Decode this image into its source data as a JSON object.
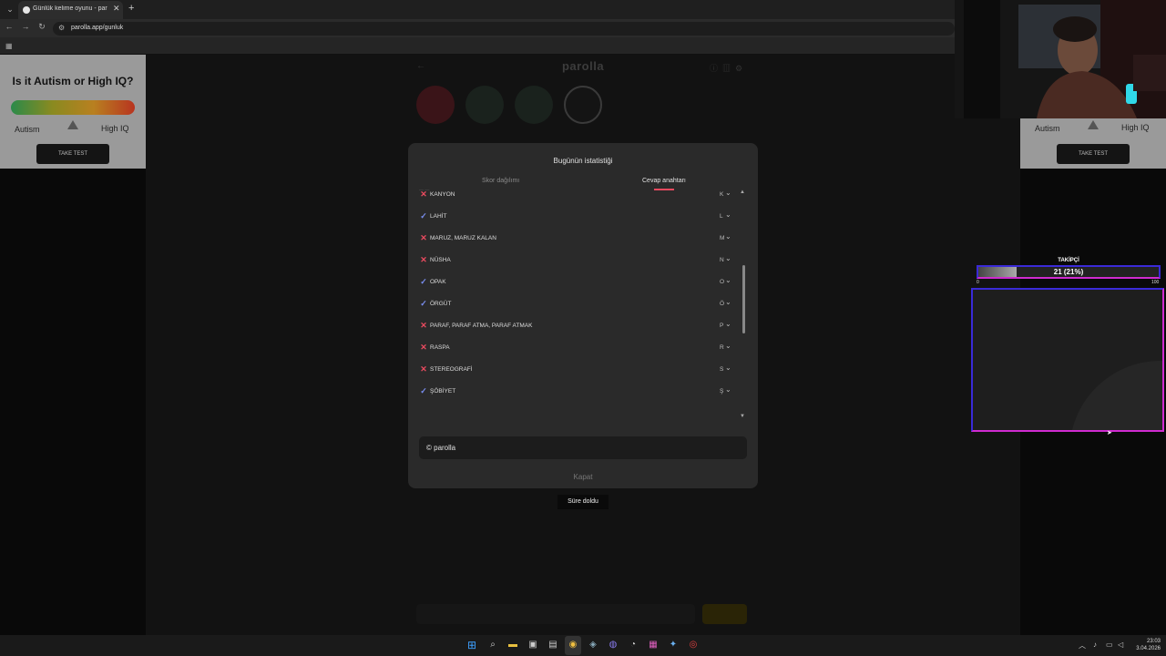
{
  "browser": {
    "tab_title": "Günlük kelime oyunu - parolla",
    "url": "parolla.app/gunluk"
  },
  "ads": {
    "title": "Is it Autism or High IQ?",
    "label_low": "Autism",
    "label_high": "High IQ",
    "button": "TAKE TEST"
  },
  "game": {
    "logo": "parolla"
  },
  "modal": {
    "title": "Bugünün istatistiği",
    "tab_scores": "Skor dağılımı",
    "tab_answers": "Cevap anahtarı",
    "answers": [
      {
        "word": "KANYON",
        "letter": "K",
        "correct": false
      },
      {
        "word": "LAHİT",
        "letter": "L",
        "correct": true
      },
      {
        "word": "MARUZ, MARUZ KALAN",
        "letter": "M",
        "correct": false
      },
      {
        "word": "NÜSHA",
        "letter": "N",
        "correct": false
      },
      {
        "word": "OPAK",
        "letter": "O",
        "correct": true
      },
      {
        "word": "ÖRGÜT",
        "letter": "Ö",
        "correct": true
      },
      {
        "word": "PARAF, PARAF ATMA, PARAF ATMAK",
        "letter": "P",
        "correct": false
      },
      {
        "word": "RASPA",
        "letter": "R",
        "correct": false
      },
      {
        "word": "STEREOGRAFİ",
        "letter": "S",
        "correct": false
      },
      {
        "word": "ŞÖBİYET",
        "letter": "Ş",
        "correct": true
      }
    ],
    "copyright": "© parolla",
    "close": "Kapat"
  },
  "status": {
    "time_up": "Süre doldu"
  },
  "follower_widget": {
    "title": "TAKİPÇİ",
    "value_text": "21 (21%)",
    "progress_percent": 21,
    "min": "0",
    "max": "100"
  },
  "taskbar": {
    "time": "23:03",
    "date": "3.04.2026"
  },
  "colors": {
    "wrong": "#e84a5f",
    "correct": "#7a8ef0",
    "accent_border": "#3a2ad8",
    "accent_border_2": "#d02bd0"
  }
}
